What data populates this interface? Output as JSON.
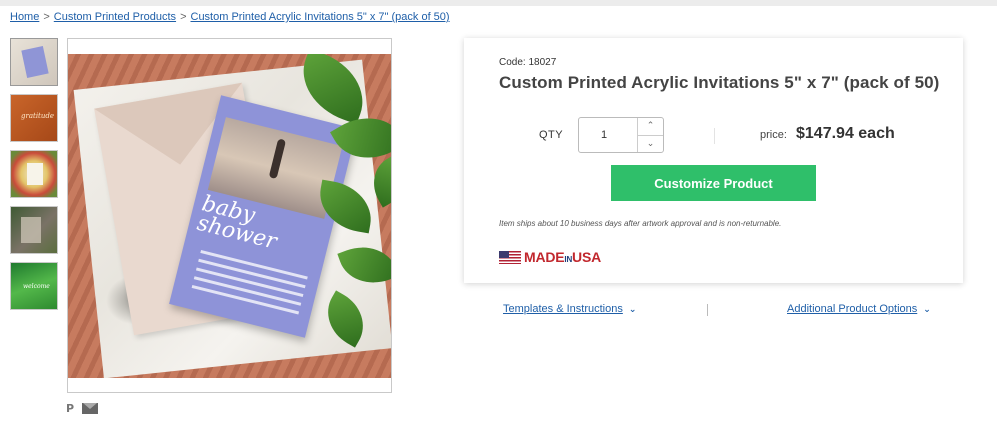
{
  "breadcrumb": {
    "items": [
      "Home",
      "Custom Printed Products",
      "Custom Printed Acrylic Invitations 5\" x 7\" (pack of 50)"
    ],
    "separator": ">"
  },
  "gallery": {
    "thumbnails": [
      {
        "name": "acrylic-invite-lavender"
      },
      {
        "name": "acrylic-invite-orange"
      },
      {
        "name": "acrylic-invite-floral"
      },
      {
        "name": "acrylic-invite-greenery"
      },
      {
        "name": "acrylic-invite-green-leaf"
      }
    ],
    "main_image": "baby shower acrylic invitation",
    "invite_script": "baby shower"
  },
  "share": {
    "pinterest_icon": "P",
    "email_icon": "mail-icon"
  },
  "product": {
    "code": "Code: 18027",
    "title": "Custom Printed Acrylic Invitations 5\" x 7\" (pack of 50)",
    "qty_label": "QTY",
    "qty_value": "1",
    "price_label": "price:",
    "price_value": "$147.94 each",
    "cta_label": "Customize Product",
    "shipping_note": "Item ships about 10 business days after artwork approval and is non-returnable.",
    "made_in": {
      "made": "MADE",
      "in": "IN",
      "usa": "USA"
    }
  },
  "links": {
    "templates": "Templates & Instructions",
    "options": "Additional Product Options"
  },
  "colors": {
    "accent_green": "#2fbf6a",
    "link_blue": "#1f5fa8",
    "made_red": "#c1272d"
  }
}
